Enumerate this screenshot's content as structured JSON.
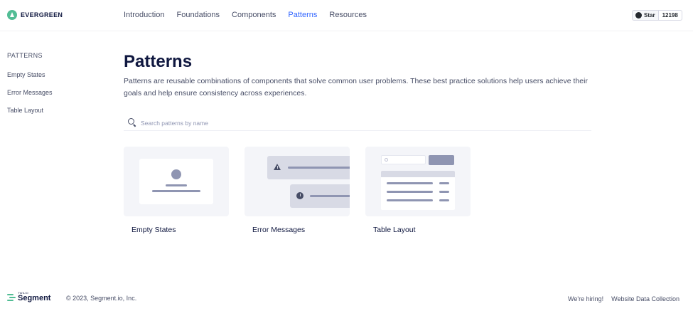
{
  "brand": {
    "name": "EVERGREEN"
  },
  "nav": {
    "items": [
      {
        "label": "Introduction",
        "active": false
      },
      {
        "label": "Foundations",
        "active": false
      },
      {
        "label": "Components",
        "active": false
      },
      {
        "label": "Patterns",
        "active": true
      },
      {
        "label": "Resources",
        "active": false
      }
    ]
  },
  "github": {
    "star_label": "Star",
    "count": "12198"
  },
  "sidebar": {
    "heading": "PATTERNS",
    "items": [
      {
        "label": "Empty States"
      },
      {
        "label": "Error Messages"
      },
      {
        "label": "Table Layout"
      }
    ]
  },
  "main": {
    "title": "Patterns",
    "description": "Patterns are reusable combinations of components that solve common user problems. These best practice solutions help users achieve their goals and help ensure consistency across experiences.",
    "search": {
      "placeholder": "Search patterns by name",
      "value": ""
    },
    "cards": [
      {
        "label": "Empty States"
      },
      {
        "label": "Error Messages"
      },
      {
        "label": "Table Layout"
      }
    ]
  },
  "footer": {
    "brand_tagline": "TWILIO",
    "brand_name": "Segment",
    "copyright": "© 2023, Segment.io, Inc.",
    "links": [
      {
        "label": "We're hiring!"
      },
      {
        "label": "Website Data Collection"
      }
    ]
  },
  "colors": {
    "accent": "#3366ff",
    "brand_green": "#52bd95",
    "heading": "#101840",
    "text": "#474d66"
  }
}
